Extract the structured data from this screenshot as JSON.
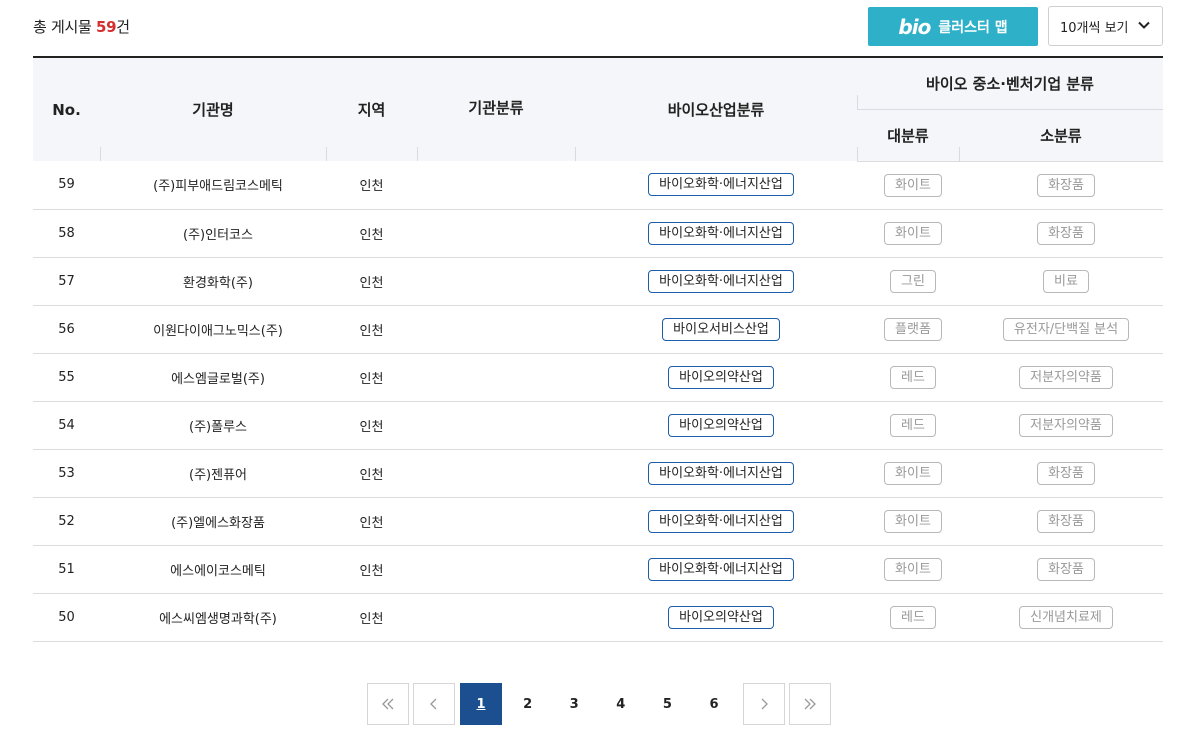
{
  "header": {
    "total_prefix": "총 게시물",
    "total_count": "59",
    "total_suffix": "건",
    "cluster_logo": "bio",
    "cluster_label": "클러스터 맵",
    "view_select": "10개씩 보기"
  },
  "table": {
    "columns": {
      "no": "No.",
      "org": "기관명",
      "region": "지역",
      "org_type": "기관분류",
      "industry": "바이오산업분류",
      "group": "바이오 중소·벤처기업 분류",
      "major": "대분류",
      "minor": "소분류"
    },
    "rows": [
      {
        "no": "59",
        "org": "(주)피부애드림코스메틱",
        "region": "인천",
        "org_type": "",
        "industry": "바이오화학·에너지산업",
        "major": "화이트",
        "minor": "화장품"
      },
      {
        "no": "58",
        "org": "(주)인터코스",
        "region": "인천",
        "org_type": "",
        "industry": "바이오화학·에너지산업",
        "major": "화이트",
        "minor": "화장품"
      },
      {
        "no": "57",
        "org": "환경화학(주)",
        "region": "인천",
        "org_type": "",
        "industry": "바이오화학·에너지산업",
        "major": "그린",
        "minor": "비료"
      },
      {
        "no": "56",
        "org": "이원다이애그노믹스(주)",
        "region": "인천",
        "org_type": "",
        "industry": "바이오서비스산업",
        "major": "플랫폼",
        "minor": "유전자/단백질 분석"
      },
      {
        "no": "55",
        "org": "에스엠글로벌(주)",
        "region": "인천",
        "org_type": "",
        "industry": "바이오의약산업",
        "major": "레드",
        "minor": "저분자의약품"
      },
      {
        "no": "54",
        "org": "(주)폴루스",
        "region": "인천",
        "org_type": "",
        "industry": "바이오의약산업",
        "major": "레드",
        "minor": "저분자의약품"
      },
      {
        "no": "53",
        "org": "(주)젠퓨어",
        "region": "인천",
        "org_type": "",
        "industry": "바이오화학·에너지산업",
        "major": "화이트",
        "minor": "화장품"
      },
      {
        "no": "52",
        "org": "(주)엘에스화장품",
        "region": "인천",
        "org_type": "",
        "industry": "바이오화학·에너지산업",
        "major": "화이트",
        "minor": "화장품"
      },
      {
        "no": "51",
        "org": "에스에이코스메틱",
        "region": "인천",
        "org_type": "",
        "industry": "바이오화학·에너지산업",
        "major": "화이트",
        "minor": "화장품"
      },
      {
        "no": "50",
        "org": "에스씨엠생명과학(주)",
        "region": "인천",
        "org_type": "",
        "industry": "바이오의약산업",
        "major": "레드",
        "minor": "신개념치료제"
      }
    ]
  },
  "pagination": {
    "pages": [
      "1",
      "2",
      "3",
      "4",
      "5",
      "6"
    ],
    "current": "1"
  },
  "colors": {
    "accent": "#2eb0c8",
    "link": "#1e5ea8",
    "count": "#d32f2f",
    "active_page": "#1c4f8f"
  }
}
